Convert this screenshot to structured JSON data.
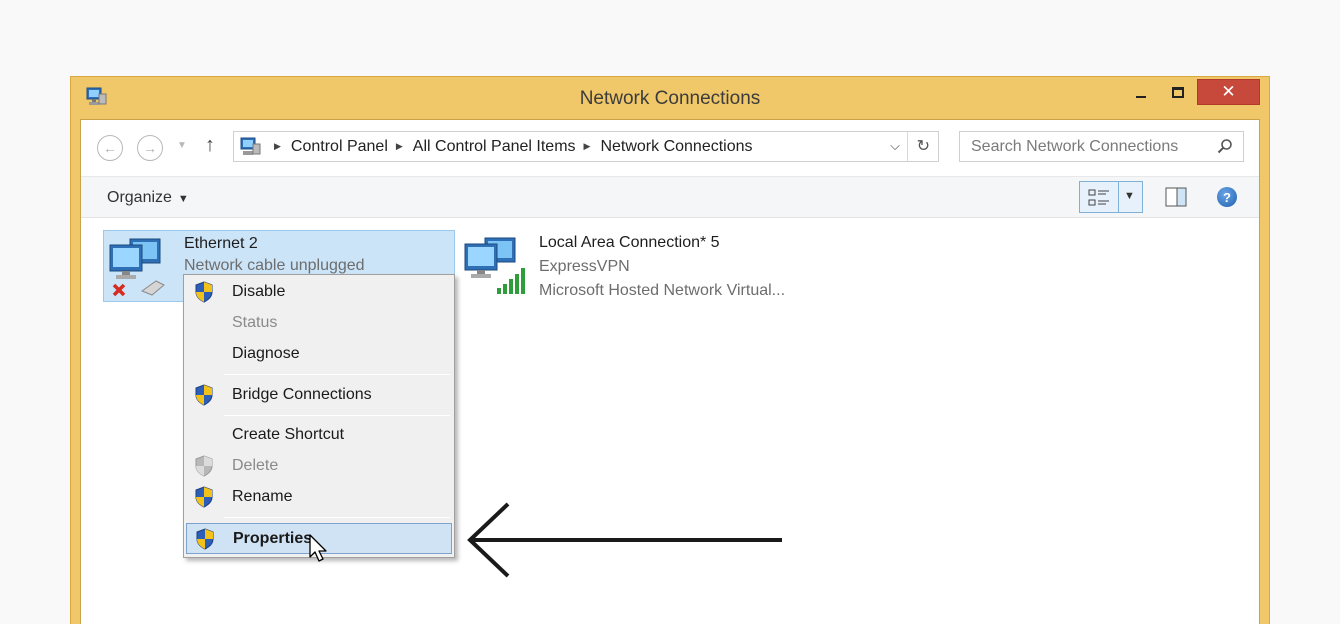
{
  "window": {
    "title": "Network Connections",
    "close_glyph": "✕",
    "accent_color": "#f0c869"
  },
  "address_bar": {
    "breadcrumbs": [
      "Control Panel",
      "All Control Panel Items",
      "Network Connections"
    ],
    "search_placeholder": "Search Network Connections"
  },
  "toolbar": {
    "organize_label": "Organize"
  },
  "connections": [
    {
      "name": "Ethernet 2",
      "line1": "Network cable unplugged",
      "line2": "",
      "icon": "ethernet-disconnected-icon",
      "selected": true
    },
    {
      "name": "Local Area Connection* 5",
      "line1": "ExpressVPN",
      "line2": "Microsoft Hosted Network Virtual...",
      "icon": "wireless-network-icon",
      "selected": false
    }
  ],
  "context_menu": {
    "items": [
      {
        "label": "Disable",
        "shield": true,
        "enabled": true
      },
      {
        "label": "Status",
        "shield": false,
        "enabled": false
      },
      {
        "label": "Diagnose",
        "shield": false,
        "enabled": true
      },
      {
        "label": "Bridge Connections",
        "shield": true,
        "enabled": true
      },
      {
        "label": "Create Shortcut",
        "shield": false,
        "enabled": true
      },
      {
        "label": "Delete",
        "shield": true,
        "enabled": false
      },
      {
        "label": "Rename",
        "shield": true,
        "enabled": true
      },
      {
        "label": "Properties",
        "shield": true,
        "enabled": true,
        "highlighted": true
      }
    ]
  },
  "annotation": {
    "icon": "arrow-left-icon"
  }
}
